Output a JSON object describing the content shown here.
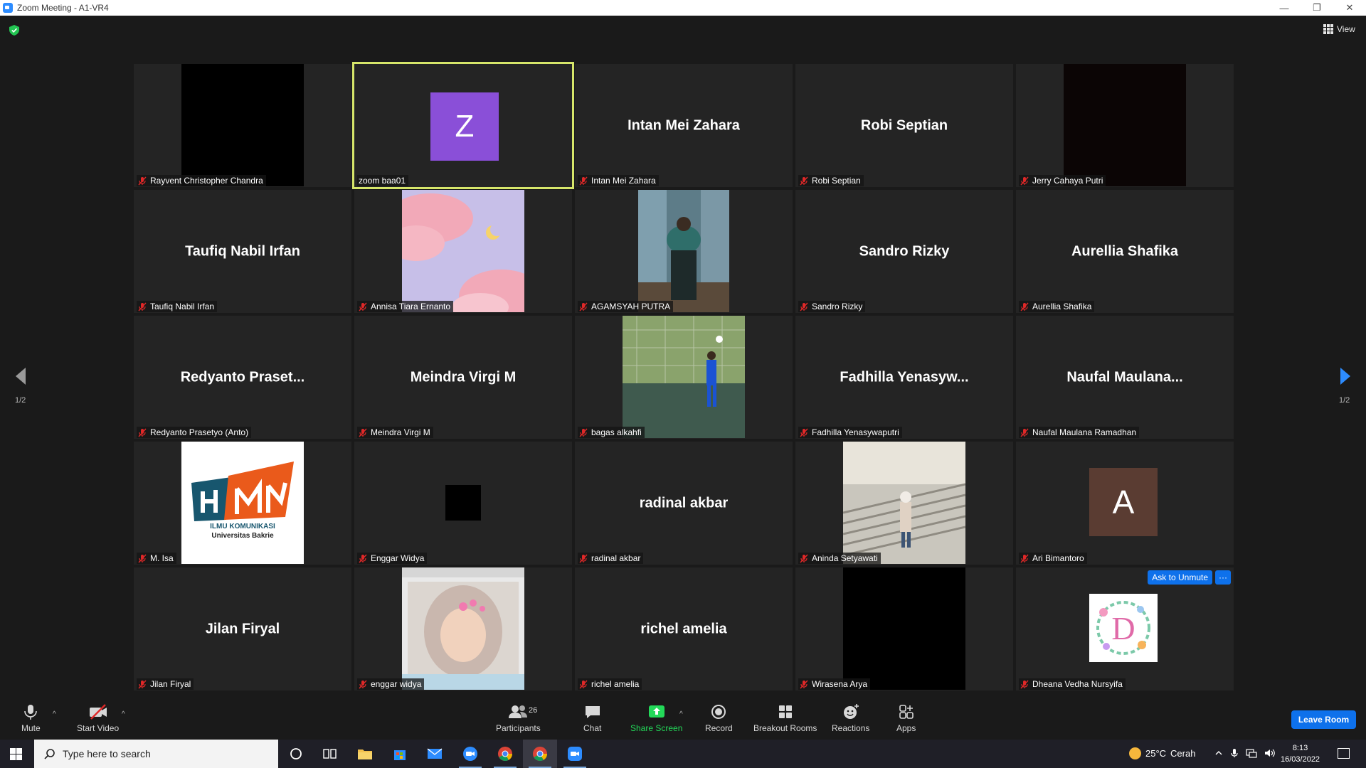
{
  "window": {
    "title": "Zoom Meeting - A1-VR4",
    "minimize": "—",
    "restore": "❐",
    "close": "✕"
  },
  "top_bar": {
    "view_label": "View"
  },
  "pagination": {
    "left_label": "1/2",
    "right_label": "1/2"
  },
  "tiles": [
    {
      "label": "Rayvent Christopher Chandra"
    },
    {
      "label": "zoom baa01",
      "avatar_letter": "Z"
    },
    {
      "label": "Intan Mei Zahara",
      "display_name": "Intan Mei Zahara"
    },
    {
      "label": "Robi Septian",
      "display_name": "Robi Septian"
    },
    {
      "label": "Jerry Cahaya Putri"
    },
    {
      "label": "Taufiq Nabil Irfan",
      "display_name": "Taufiq Nabil Irfan"
    },
    {
      "label": "Annisa Tiara Ernanto"
    },
    {
      "label": "AGAMSYAH PUTRA"
    },
    {
      "label": "Sandro Rizky",
      "display_name": "Sandro Rizky"
    },
    {
      "label": "Aurellia Shafika",
      "display_name": "Aurellia Shafika"
    },
    {
      "label": "Redyanto Prasetyo (Anto)",
      "display_name": "Redyanto  Praset..."
    },
    {
      "label": "Meindra Virgi M",
      "display_name": "Meindra Virgi M"
    },
    {
      "label": "bagas alkahfi"
    },
    {
      "label": "Fadhilla Yenasywaputri",
      "display_name": "Fadhilla  Yenasyw..."
    },
    {
      "label": "Naufal Maulana Ramadhan",
      "display_name": "Naufal  Maulana..."
    },
    {
      "label": "M. Isa",
      "logo_line1": "ILMU KOMUNIKASI",
      "logo_line2": "Universitas Bakrie"
    },
    {
      "label": "Enggar Widya"
    },
    {
      "label": "radinal akbar",
      "display_name": "radinal akbar"
    },
    {
      "label": "Aninda Setyawati"
    },
    {
      "label": "Ari Bimantoro",
      "avatar_letter": "A"
    },
    {
      "label": "Jilan Firyal",
      "display_name": "Jilan Firyal"
    },
    {
      "label": "enggar widya"
    },
    {
      "label": "richel amelia",
      "display_name": "richel amelia"
    },
    {
      "label": "Wirasena Arya"
    },
    {
      "label": "Dheana Vedha Nursyifa",
      "avatar_letter": "D",
      "ask_unmute": "Ask to Unmute",
      "more": "···"
    }
  ],
  "toolbar": {
    "mute": "Mute",
    "start_video": "Start Video",
    "participants": "Participants",
    "participants_count": "26",
    "chat": "Chat",
    "share_screen": "Share Screen",
    "record": "Record",
    "breakout_rooms": "Breakout Rooms",
    "reactions": "Reactions",
    "apps": "Apps",
    "leave": "Leave Room",
    "caret": "^"
  },
  "taskbar": {
    "search_placeholder": "Type here to search",
    "weather_temp": "25°C",
    "weather_desc": "Cerah",
    "time": "8:13",
    "date": "16/03/2022"
  },
  "colors": {
    "active_speaker_border": "#d6e66a",
    "zoom_blue": "#0e71eb",
    "share_green": "#23d959",
    "mic_off_red": "#e02828"
  }
}
